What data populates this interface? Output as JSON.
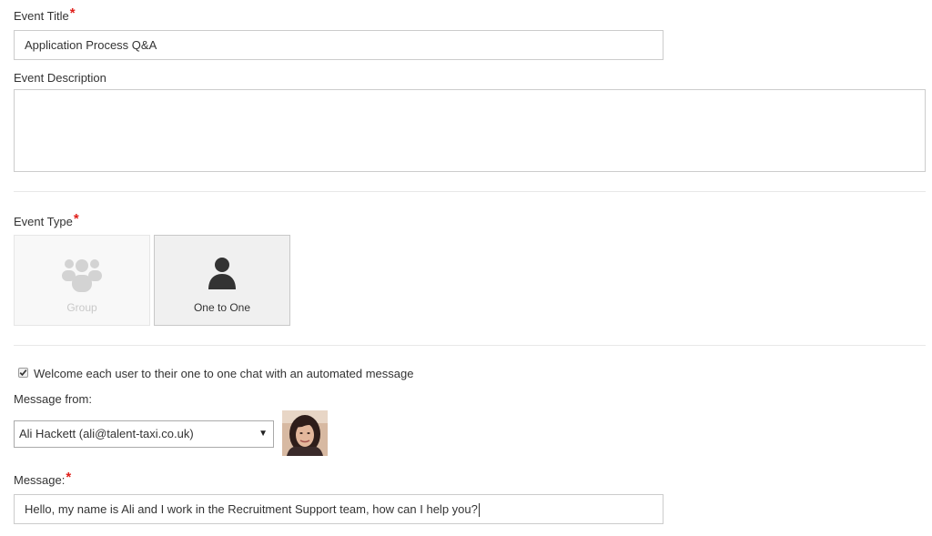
{
  "event_title": {
    "label": "Event Title",
    "required_mark": "*",
    "value": "Application Process Q&A"
  },
  "event_description": {
    "label": "Event Description",
    "value": ""
  },
  "event_type": {
    "label": "Event Type",
    "required_mark": "*",
    "options": [
      {
        "label": "Group",
        "icon": "group-icon",
        "selected": false
      },
      {
        "label": "One to One",
        "icon": "user-icon",
        "selected": true
      }
    ]
  },
  "welcome": {
    "checkbox_checked": true,
    "checkbox_label": "Welcome each user to their one to one chat with an automated message"
  },
  "message_from": {
    "label": "Message from:",
    "selected": "Ali Hackett (ali@talent-taxi.co.uk)",
    "arrow": "▼",
    "avatar": "avatar-photo"
  },
  "message": {
    "label": "Message:",
    "required_mark": "*",
    "value": "Hello, my name is Ali and I work in the Recruitment Support team, how can I help you?"
  },
  "colors": {
    "required": "#e0201b",
    "border": "#cccccc",
    "selected_card": "#f0f0f0"
  }
}
